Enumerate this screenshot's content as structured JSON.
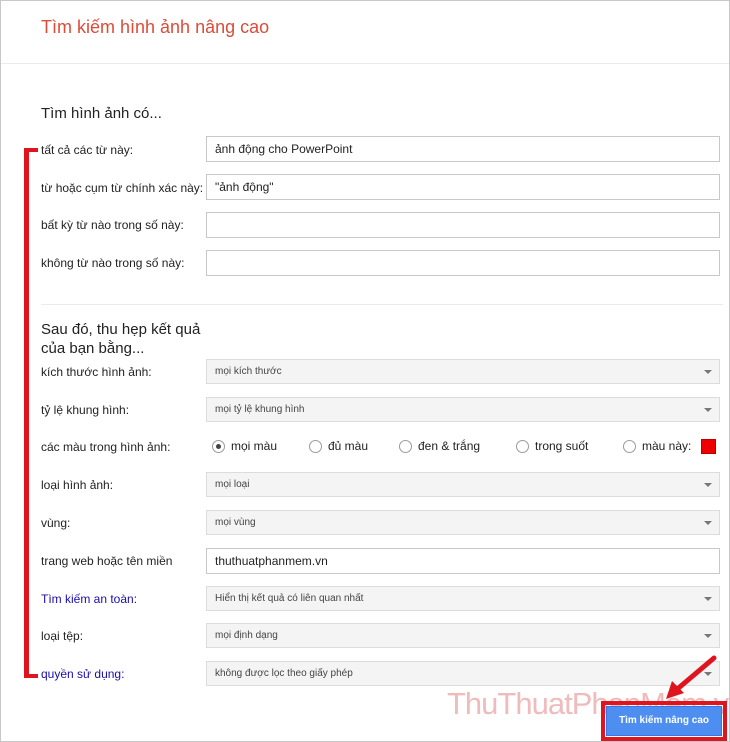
{
  "page": {
    "title": "Tìm kiếm hình ảnh nâng cao"
  },
  "find_section": {
    "heading": "Tìm hình ảnh có...",
    "all_words": {
      "label": "tất cả các từ này:",
      "value": "ảnh động cho PowerPoint"
    },
    "exact_phrase": {
      "label": "từ hoặc cụm từ chính xác này:",
      "value": "\"ảnh động\""
    },
    "any_words": {
      "label": "bất kỳ từ nào trong số này:",
      "value": ""
    },
    "none_words": {
      "label": "không từ nào trong số này:",
      "value": ""
    }
  },
  "narrow_section": {
    "heading_line1": "Sau đó, thu hẹp kết quả",
    "heading_line2": "của bạn bằng...",
    "image_size": {
      "label": "kích thước hình ảnh:",
      "value": "mọi kích thước"
    },
    "aspect_ratio": {
      "label": "tỷ lệ khung hình:",
      "value": "mọi tỷ lệ khung hình"
    },
    "colors": {
      "label": "các màu trong hình ảnh:",
      "options": [
        "mọi màu",
        "đủ màu",
        "đen & trắng",
        "trong suốt",
        "màu này:"
      ],
      "selected_index": 0,
      "swatch_color": "#ee0000"
    },
    "image_type": {
      "label": "loại hình ảnh:",
      "value": "mọi loại"
    },
    "region": {
      "label": "vùng:",
      "value": "mọi vùng"
    },
    "site": {
      "label": "trang web hoặc tên miền",
      "value": "thuthuatphanmem.vn"
    },
    "safe_search": {
      "label": "Tìm kiếm an toàn:",
      "value": "Hiển thị kết quả có liên quan nhất"
    },
    "file_type": {
      "label": "loại tệp:",
      "value": "mọi định dạng"
    },
    "usage_rights": {
      "label": "quyền sử dụng:",
      "value": "không được lọc theo giấy phép"
    }
  },
  "submit_label": "Tìm kiếm nâng cao",
  "watermark": "ThuThuatPhanMem.vn",
  "colors": {
    "accent_red": "#dd4b39",
    "link_blue": "#1a0dab",
    "button_blue": "#4d8ef0",
    "annotation_red": "#e0141e"
  }
}
